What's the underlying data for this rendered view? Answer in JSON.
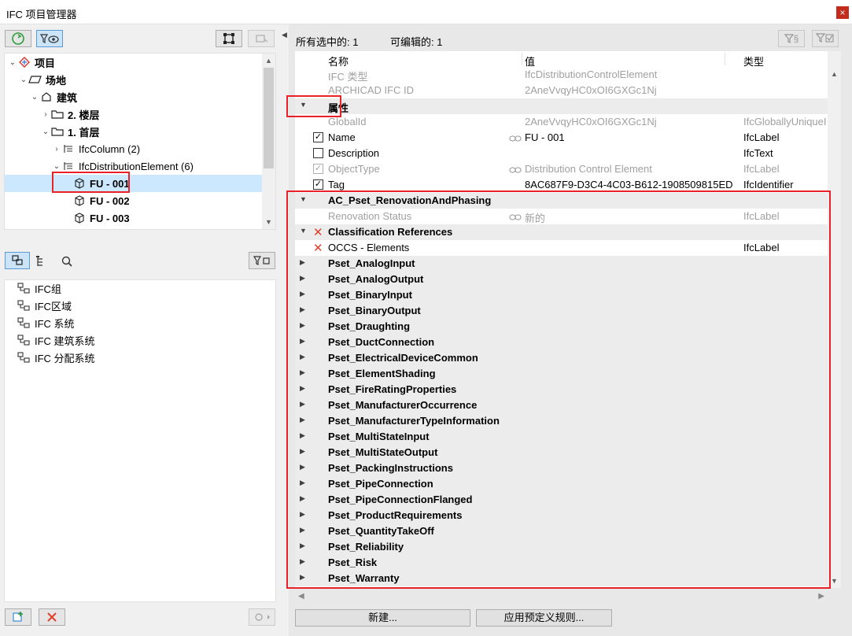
{
  "window": {
    "title": "IFC 项目管理器",
    "close_glyph": "×"
  },
  "tree": {
    "items": [
      {
        "label": "项目",
        "bold": true,
        "icon": "project-icon",
        "arrow": "expanded"
      },
      {
        "label": "场地",
        "bold": true,
        "icon": "site-icon",
        "arrow": "expanded"
      },
      {
        "label": "建筑",
        "bold": true,
        "icon": "building-icon",
        "arrow": "expanded"
      },
      {
        "label": "2. 楼层",
        "bold": true,
        "icon": "folder-icon",
        "arrow": "collapsed"
      },
      {
        "label": "1. 首层",
        "bold": true,
        "icon": "folder-icon",
        "arrow": "expanded"
      },
      {
        "label": "IfcColumn (2)",
        "bold": false,
        "icon": "class-icon",
        "arrow": "collapsed"
      },
      {
        "label": "IfcDistributionElement (6)",
        "bold": false,
        "icon": "class-icon",
        "arrow": "expanded"
      },
      {
        "label": "FU - 001",
        "bold": true,
        "icon": "element-icon",
        "arrow": "none"
      },
      {
        "label": "FU - 002",
        "bold": true,
        "icon": "element-icon",
        "arrow": "none"
      },
      {
        "label": "FU - 003",
        "bold": true,
        "icon": "element-icon",
        "arrow": "none"
      }
    ]
  },
  "lower_list": {
    "items": [
      {
        "label": "IFC组",
        "icon": "group-icon"
      },
      {
        "label": "IFC区域",
        "icon": "zone-icon"
      },
      {
        "label": "IFC 系统",
        "icon": "system-icon"
      },
      {
        "label": "IFC 建筑系统",
        "icon": "building-system-icon"
      },
      {
        "label": "IFC 分配系统",
        "icon": "distribution-system-icon"
      }
    ]
  },
  "right": {
    "selected_count_label": "所有选中的: 1",
    "editable_count_label": "可编辑的: 1",
    "columns": {
      "name": "名称",
      "value": "值",
      "type": "类型"
    },
    "rows": [
      {
        "kind": "prop",
        "light": true,
        "name": "IFC 类型",
        "value": "IfcDistributionControlElement",
        "type": ""
      },
      {
        "kind": "prop",
        "light": true,
        "name": "ARCHICAD IFC ID",
        "value": "2AneVvqyHC0xOI6GXGc1Nj",
        "type": ""
      },
      {
        "kind": "group",
        "expanded": true,
        "name": "属性"
      },
      {
        "kind": "prop",
        "light": true,
        "name": "GlobalId",
        "value": "2AneVvqyHC0xOI6GXGc1Nj",
        "type": "IfcGloballyUniqueI"
      },
      {
        "kind": "prop",
        "check": "checked",
        "link": true,
        "name": "Name",
        "value": "FU - 001",
        "type": "IfcLabel"
      },
      {
        "kind": "prop",
        "check": "empty",
        "name": "Description",
        "value": "",
        "type": "IfcText"
      },
      {
        "kind": "prop",
        "light": true,
        "check": "grey",
        "link": true,
        "name": "ObjectType",
        "value": "Distribution Control Element",
        "type": "IfcLabel"
      },
      {
        "kind": "prop",
        "check": "checked",
        "name": "Tag",
        "value": "8AC687F9-D3C4-4C03-B612-1908509815ED",
        "type": "IfcIdentifier"
      },
      {
        "kind": "group",
        "expanded": true,
        "name": "AC_Pset_RenovationAndPhasing"
      },
      {
        "kind": "prop",
        "light": true,
        "link": true,
        "name": "Renovation Status",
        "value": "新的",
        "type": "IfcLabel"
      },
      {
        "kind": "group",
        "expanded": true,
        "x": true,
        "name": "Classification References"
      },
      {
        "kind": "prop",
        "x": true,
        "name": "OCCS - Elements",
        "value": "",
        "type": "IfcLabel"
      },
      {
        "kind": "group",
        "name": "Pset_AnalogInput"
      },
      {
        "kind": "group",
        "name": "Pset_AnalogOutput"
      },
      {
        "kind": "group",
        "name": "Pset_BinaryInput"
      },
      {
        "kind": "group",
        "name": "Pset_BinaryOutput"
      },
      {
        "kind": "group",
        "name": "Pset_Draughting"
      },
      {
        "kind": "group",
        "name": "Pset_DuctConnection"
      },
      {
        "kind": "group",
        "name": "Pset_ElectricalDeviceCommon"
      },
      {
        "kind": "group",
        "name": "Pset_ElementShading"
      },
      {
        "kind": "group",
        "name": "Pset_FireRatingProperties"
      },
      {
        "kind": "group",
        "name": "Pset_ManufacturerOccurrence"
      },
      {
        "kind": "group",
        "name": "Pset_ManufacturerTypeInformation"
      },
      {
        "kind": "group",
        "name": "Pset_MultiStateInput"
      },
      {
        "kind": "group",
        "name": "Pset_MultiStateOutput"
      },
      {
        "kind": "group",
        "name": "Pset_PackingInstructions"
      },
      {
        "kind": "group",
        "name": "Pset_PipeConnection"
      },
      {
        "kind": "group",
        "name": "Pset_PipeConnectionFlanged"
      },
      {
        "kind": "group",
        "name": "Pset_ProductRequirements"
      },
      {
        "kind": "group",
        "name": "Pset_QuantityTakeOff"
      },
      {
        "kind": "group",
        "name": "Pset_Reliability"
      },
      {
        "kind": "group",
        "name": "Pset_Risk"
      },
      {
        "kind": "group",
        "name": "Pset_Warranty"
      }
    ],
    "buttons": {
      "new": "新建...",
      "apply_rules": "应用预定义规则..."
    },
    "filter_label": "§"
  },
  "colors": {
    "highlight": "#e8212a",
    "selection": "#cce8ff",
    "accent": "#3a8ad8"
  }
}
